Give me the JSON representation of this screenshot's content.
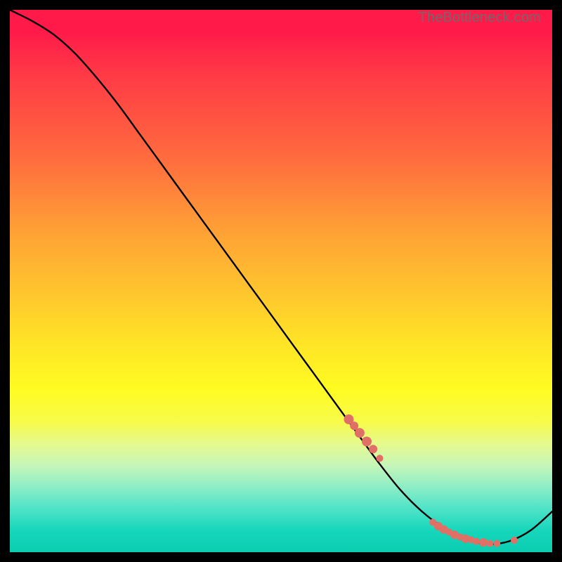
{
  "watermark": "TheBottleneck.com",
  "chart_data": {
    "type": "line",
    "title": "",
    "xlabel": "",
    "ylabel": "",
    "xlim": [
      0,
      100
    ],
    "ylim": [
      0,
      100
    ],
    "grid": false,
    "legend": false,
    "series": [
      {
        "name": "bottleneck-curve",
        "x": [
          0,
          4,
          8,
          12,
          16,
          20,
          24,
          28,
          32,
          36,
          40,
          44,
          48,
          52,
          56,
          60,
          64,
          68,
          72,
          76,
          80,
          84,
          88,
          92,
          96,
          100
        ],
        "y": [
          100,
          98,
          95.5,
          92,
          87.5,
          82.5,
          77,
          71.5,
          66,
          60.5,
          55,
          49.5,
          44,
          38.5,
          33,
          27.5,
          22,
          16.5,
          11.5,
          7.5,
          4.5,
          2.5,
          1.5,
          2,
          4,
          7.5
        ]
      }
    ],
    "markers": {
      "name": "highlighted-points",
      "color": "#e07066",
      "radius_default": 5,
      "points": [
        {
          "x": 62.5,
          "y": 24.5,
          "r": 7
        },
        {
          "x": 63.5,
          "y": 23.3,
          "r": 6
        },
        {
          "x": 64.5,
          "y": 22.0,
          "r": 7
        },
        {
          "x": 65.8,
          "y": 20.4,
          "r": 7
        },
        {
          "x": 67.0,
          "y": 19.0,
          "r": 6
        },
        {
          "x": 68.2,
          "y": 17.3,
          "r": 5
        },
        {
          "x": 78.0,
          "y": 5.5,
          "r": 5
        },
        {
          "x": 79.0,
          "y": 4.8,
          "r": 6
        },
        {
          "x": 80.0,
          "y": 4.2,
          "r": 6
        },
        {
          "x": 81.0,
          "y": 3.7,
          "r": 5
        },
        {
          "x": 82.0,
          "y": 3.2,
          "r": 6
        },
        {
          "x": 83.0,
          "y": 2.8,
          "r": 5
        },
        {
          "x": 84.0,
          "y": 2.5,
          "r": 6
        },
        {
          "x": 85.0,
          "y": 2.3,
          "r": 5
        },
        {
          "x": 86.0,
          "y": 2.0,
          "r": 5
        },
        {
          "x": 87.3,
          "y": 1.8,
          "r": 6
        },
        {
          "x": 88.5,
          "y": 1.6,
          "r": 5
        },
        {
          "x": 89.8,
          "y": 1.6,
          "r": 5
        },
        {
          "x": 93.0,
          "y": 2.2,
          "r": 5
        }
      ]
    }
  }
}
